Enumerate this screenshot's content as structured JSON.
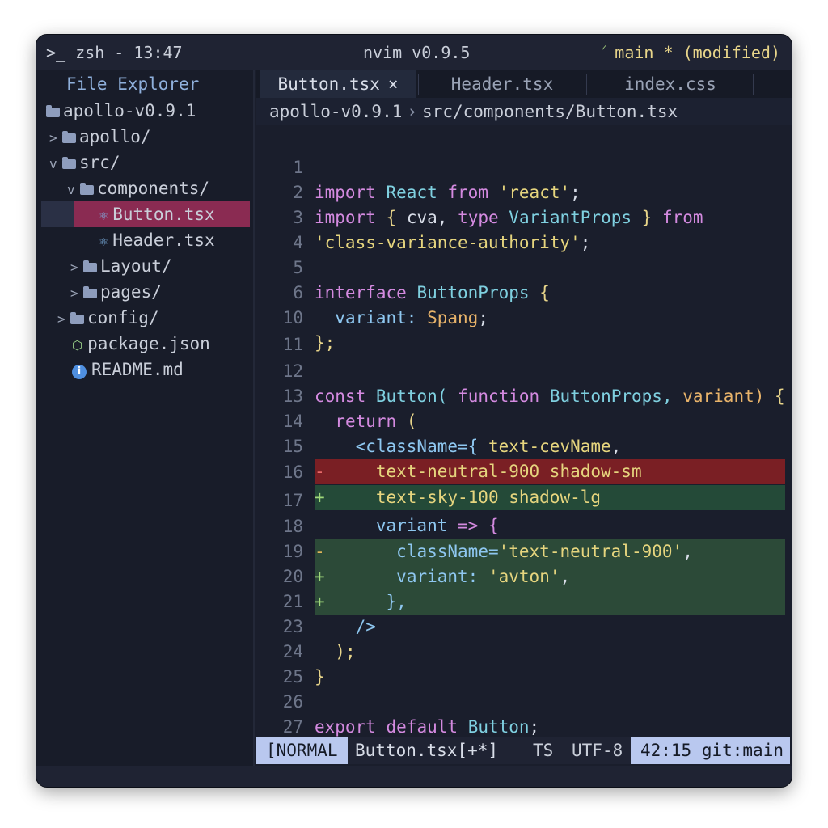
{
  "titlebar": {
    "left": ">_ zsh - 13:47",
    "center": "nvim v0.9.5",
    "branch_icon": "git-branch-icon",
    "right": "main * (modified)"
  },
  "sidebar": {
    "title": "File Explorer",
    "items": [
      {
        "label": "apollo-v0.9.1",
        "icon": "folder-icon"
      },
      {
        "label": "apollo/",
        "icon": "folder-icon",
        "chevron": ">"
      },
      {
        "label": "src/",
        "icon": "folder-open-icon",
        "chevron": "v"
      },
      {
        "label": "components/",
        "icon": "folder-open-icon",
        "chevron": "v"
      },
      {
        "label": "Button.tsx",
        "icon": "react-icon"
      },
      {
        "label": "Header.tsx",
        "icon": "react-icon"
      },
      {
        "label": "Layout/",
        "icon": "folder-icon",
        "chevron": ">"
      },
      {
        "label": "pages/",
        "icon": "folder-icon",
        "chevron": ">"
      },
      {
        "label": "config/",
        "icon": "folder-icon",
        "chevron": ">"
      },
      {
        "label": "package.json",
        "icon": "json-icon"
      },
      {
        "label": "README.md",
        "icon": "info-icon"
      }
    ]
  },
  "tabs": [
    {
      "label": "Button.tsx",
      "close": "×"
    },
    {
      "label": "Header.tsx"
    },
    {
      "label": "index.css"
    }
  ],
  "breadcrumb": {
    "root": "apollo-v0.9.1",
    "path": "src/components/Button.tsx"
  },
  "code": {
    "line_numbers": [
      "1",
      "2",
      "3",
      "4",
      "5",
      "6",
      "10",
      "11",
      "12",
      "13",
      "14",
      "15",
      "16",
      "17",
      "18",
      "19",
      "20",
      "21",
      "23",
      "24",
      "25",
      "26",
      "27"
    ],
    "l1": {
      "a": "import",
      "b": "React",
      "c": "from",
      "d": "'react'",
      "e": ";"
    },
    "l2": {
      "a": "import",
      "b": "{",
      "c": "cva,",
      "d": "type",
      "e": "VariantProps",
      "f": "}",
      "g": "from"
    },
    "l3": {
      "a": "'class-variance-authority'",
      "b": ";"
    },
    "l5": {
      "a": "interface",
      "b": "ButtonProps",
      "c": "{"
    },
    "l6": {
      "a": "variant:",
      "b": "Spang",
      "c": ";"
    },
    "l10": {
      "a": "};"
    },
    "l12": {
      "a": "const",
      "b": "Button(",
      "c": "function",
      "d": "ButtonProps,",
      "e": "variant)",
      "f": "{"
    },
    "l13": {
      "a": "return",
      "b": "("
    },
    "l14": {
      "a": "<className={",
      "b": "text-cevName",
      "c": ","
    },
    "l15": {
      "mark": "-",
      "a": "text-neutral-900 shadow-sm"
    },
    "l16": {
      "mark": "+",
      "a": "text-sky-100 shadow-lg"
    },
    "l17": {
      "a": "variant",
      "b": "=>",
      "c": "{"
    },
    "l18": {
      "mark": "-",
      "a": "className=",
      "b": "'text-neutral-900'",
      "c": ","
    },
    "l19": {
      "mark": "+",
      "a": "variant:",
      "b": "'avton'",
      "c": ","
    },
    "l20": {
      "mark": "+",
      "a": "},"
    },
    "l21": {
      "a": "/>"
    },
    "l23": {
      "a": ");"
    },
    "l24": {
      "a": "}"
    },
    "l26": {
      "a": "export",
      "b": "default",
      "c": "Button",
      "d": ";"
    }
  },
  "statusbar": {
    "mode": "[NORMAL",
    "file": "Button.tsx[+*]",
    "lang": "TS",
    "encoding": "UTF-8",
    "position": "42:15 git:main"
  },
  "colors": {
    "background": "#1a1e2c",
    "selected_file": "#8a2b52",
    "diff_delete": "#7a1f24",
    "diff_add": "#244a38",
    "status_accent": "#b9c8ef"
  }
}
